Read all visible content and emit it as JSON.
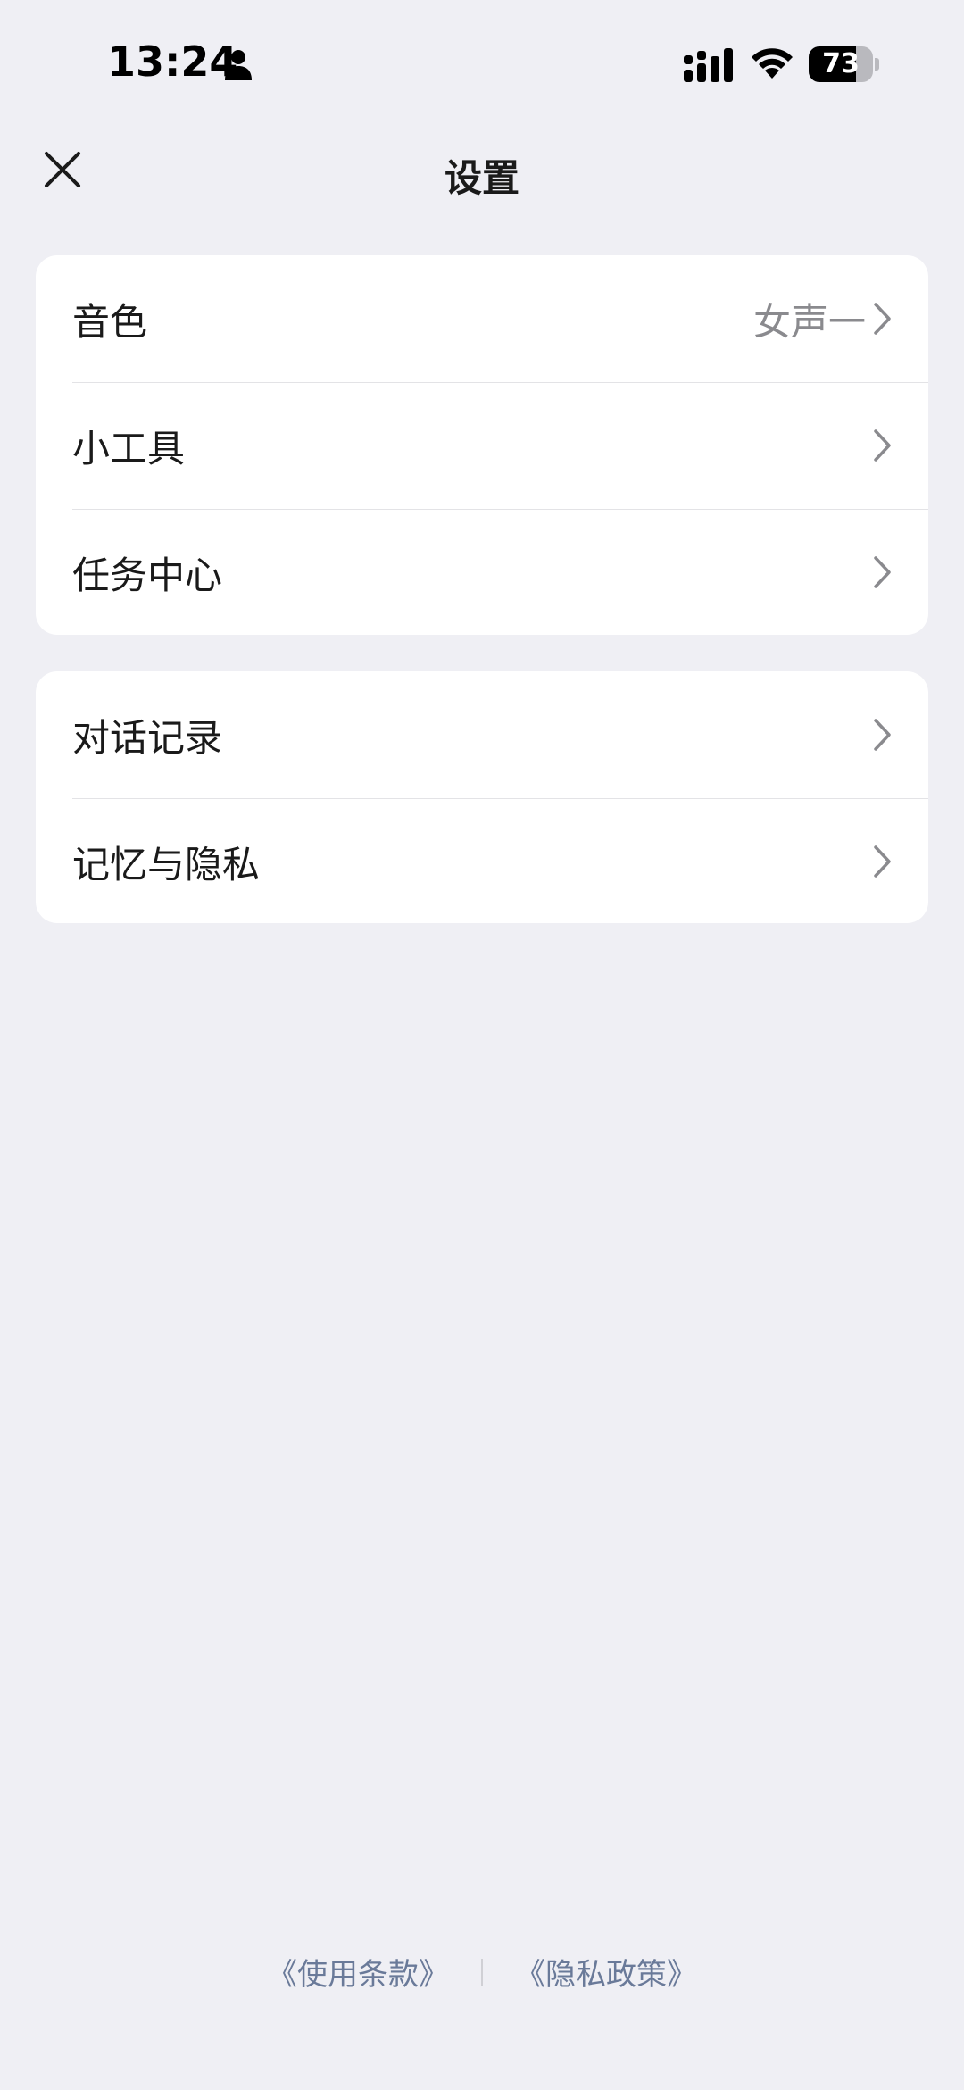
{
  "status_bar": {
    "time": "13:24",
    "battery_level": "73",
    "battery_fraction": 0.73
  },
  "header": {
    "title": "设置",
    "close_icon": "close-icon"
  },
  "groups": [
    {
      "items": [
        {
          "label": "音色",
          "value": "女声一"
        },
        {
          "label": "小工具",
          "value": ""
        },
        {
          "label": "任务中心",
          "value": ""
        }
      ]
    },
    {
      "items": [
        {
          "label": "对话记录",
          "value": ""
        },
        {
          "label": "记忆与隐私",
          "value": ""
        }
      ]
    }
  ],
  "footer": {
    "terms": "《使用条款》",
    "privacy": "《隐私政策》"
  },
  "colors": {
    "background": "#efeff4",
    "card": "#ffffff",
    "secondary_text": "#8a8a8e",
    "link": "#6a7a99"
  }
}
